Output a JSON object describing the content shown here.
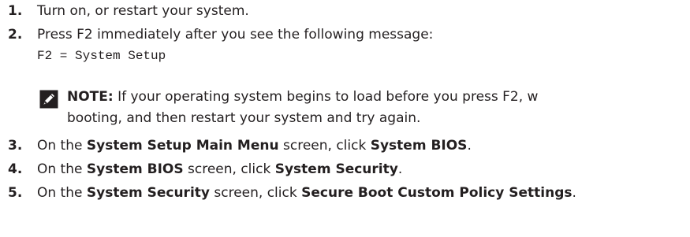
{
  "steps": [
    {
      "number": "1.",
      "parts": [
        {
          "text": "Turn on, or restart your system.",
          "bold": false
        }
      ]
    },
    {
      "number": "2.",
      "parts": [
        {
          "text": "Press F2 immediately after you see the following message:",
          "bold": false
        }
      ]
    },
    {
      "number": "3.",
      "parts": [
        {
          "text": "On the ",
          "bold": false
        },
        {
          "text": "System Setup Main Menu",
          "bold": true
        },
        {
          "text": " screen, click ",
          "bold": false
        },
        {
          "text": "System BIOS",
          "bold": true
        },
        {
          "text": ".",
          "bold": false
        }
      ]
    },
    {
      "number": "4.",
      "parts": [
        {
          "text": "On the ",
          "bold": false
        },
        {
          "text": "System BIOS",
          "bold": true
        },
        {
          "text": " screen, click ",
          "bold": false
        },
        {
          "text": "System Security",
          "bold": true
        },
        {
          "text": ".",
          "bold": false
        }
      ]
    },
    {
      "number": "5.",
      "parts": [
        {
          "text": "On the ",
          "bold": false
        },
        {
          "text": "System Security",
          "bold": true
        },
        {
          "text": " screen, click ",
          "bold": false
        },
        {
          "text": "Secure Boot Custom Policy Settings",
          "bold": true
        },
        {
          "text": ".",
          "bold": false
        }
      ]
    }
  ],
  "code_message": "F2 = System Setup",
  "note": {
    "icon": "pencil-note-icon",
    "label": "NOTE:",
    "line1": " If your operating system begins to load before you press F2, w",
    "line2": "booting, and then restart your system and try again."
  }
}
